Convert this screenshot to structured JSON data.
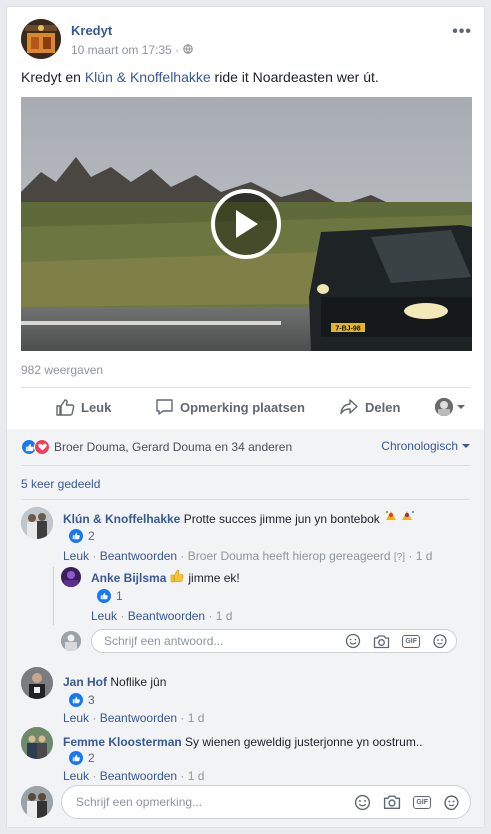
{
  "post": {
    "page_name": "Kredyt",
    "date": "10 maart om 17:35 ·",
    "text_pre": "Kredyt en ",
    "text_mention": "Klún & Knoffelhakke",
    "text_post": " ride it Noardeasten wer út.",
    "more": "•••",
    "views": "982 weergaven",
    "plate": "7-BJ-98"
  },
  "actions": {
    "like": "Leuk",
    "comment": "Opmerking plaatsen",
    "share": "Delen"
  },
  "reactions": {
    "names": "Broer Douma, Gerard Douma en 34 anderen",
    "order": "Chronologisch",
    "shares": "5 keer gedeeld"
  },
  "comments": [
    {
      "name": "Klún & Knoffelhakke",
      "text": "Protte succes jimme jun yn bontebok",
      "likes": "2",
      "like": "Leuk",
      "reply": "Beantwoorden",
      "reacted": "Broer Douma heeft hierop gereageerd",
      "edit_mark": "[?]",
      "time": "1 d",
      "replies": [
        {
          "name": "Anke Bijlsma",
          "text": "jimme ek!",
          "likes": "1",
          "like": "Leuk",
          "reply": "Beantwoorden",
          "time": "1 d"
        }
      ]
    },
    {
      "name": "Jan Hof",
      "text": "Noflike jûn",
      "likes": "3",
      "like": "Leuk",
      "reply": "Beantwoorden",
      "time": "1 d"
    },
    {
      "name": "Femme Kloosterman",
      "text": "Sy wienen geweldig justerjonne yn oostrum..",
      "likes": "2",
      "like": "Leuk",
      "reply": "Beantwoorden",
      "time": "1 d"
    }
  ],
  "inputs": {
    "reply_placeholder": "Schrijf een antwoord...",
    "comment_placeholder": "Schrijf een opmerking..."
  },
  "gif_label": "GIF",
  "colors": {
    "link": "#385898",
    "like_blue": "#1877f2",
    "love_red": "#f33e58"
  }
}
